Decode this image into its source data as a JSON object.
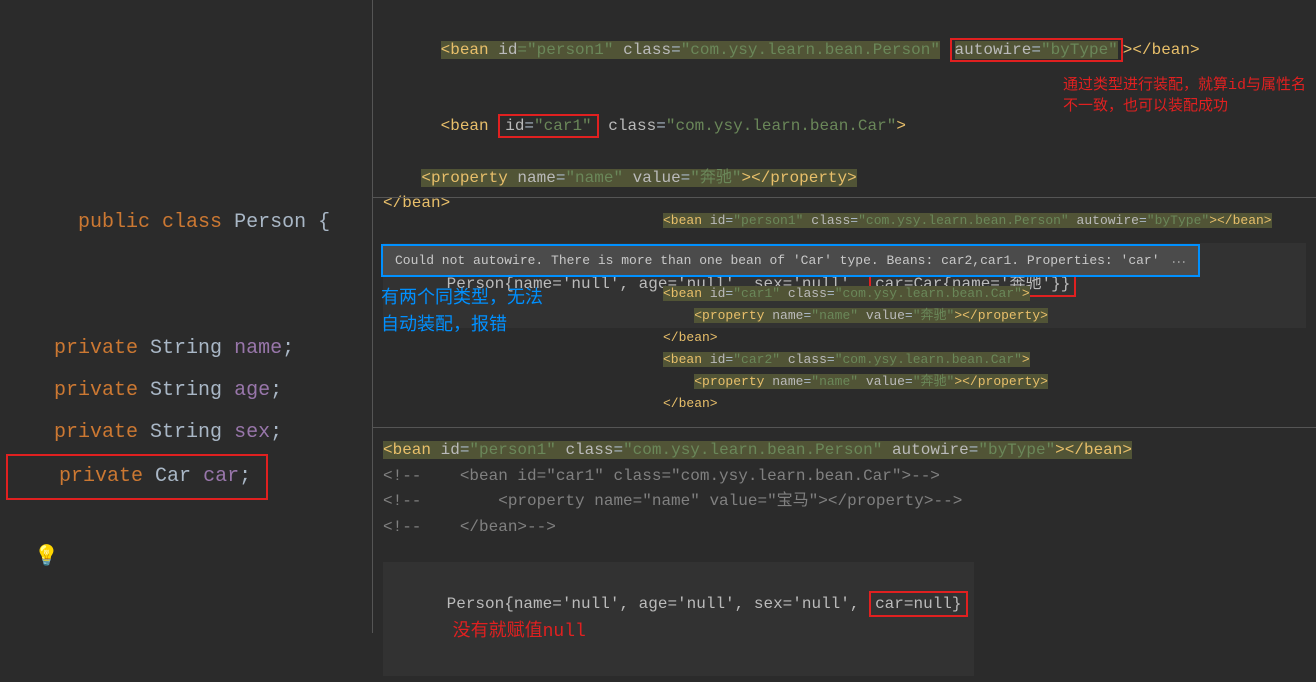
{
  "left": {
    "decl": {
      "kw1": "public",
      "kw2": "class",
      "name": "Person",
      "brace": "{"
    },
    "f1": {
      "kw": "private",
      "type": "String",
      "name": "name",
      "semi": ";"
    },
    "f2": {
      "kw": "private",
      "type": "String",
      "name": "age",
      "semi": ";"
    },
    "f3": {
      "kw": "private",
      "type": "String",
      "name": "sex",
      "semi": ";"
    },
    "f4": {
      "kw": "private",
      "type": "Car",
      "name": "car",
      "semi": ";"
    }
  },
  "sec1": {
    "line1": {
      "open": "<bean ",
      "a1n": "id",
      "eq": "=",
      "a1v": "\"person1\"",
      "a2n": "class",
      "a2v": "\"com.ysy.learn.bean.Person\"",
      "a3n": "autowire",
      "a3v": "\"byType\"",
      "close": "></bean>"
    },
    "line2": {
      "open": "<bean ",
      "a1n": "id",
      "a1v": "\"car1\"",
      "a2n": "class",
      "a2v": "\"com.ysy.learn.bean.Car\"",
      "close": ">"
    },
    "line3": {
      "indent": "    ",
      "open": "<property ",
      "a1n": "name",
      "a1v": "\"name\"",
      "a2n": "value",
      "a2v": "\"奔驰\"",
      "close": "></property>"
    },
    "line4": "</bean>",
    "ann1": "通过类型进行装配，就算id与属性名",
    "ann2": "不一致，也可以装配成功",
    "out_prefix": "Person{name='null', age='null', sex='null', ",
    "out_box": "car=Car{name='奔驰'}}"
  },
  "sec2": {
    "top": {
      "open": "<bean ",
      "a1n": "id",
      "a1v": "\"person1\"",
      "a2n": "class",
      "a2v": "\"com.ysy.learn.bean.Person\"",
      "a3n": "autowire",
      "a3v": "\"byType\"",
      "close": "></bean>"
    },
    "tooltip": "Could not autowire. There is more than one bean of 'Car' type. Beans: car2,car1. Properties: 'car'",
    "ann1": "有两个同类型，无法",
    "ann2": "自动装配，报错",
    "car1": {
      "open": "<bean ",
      "a1n": "id",
      "a1v": "\"car1\"",
      "a2n": "class",
      "a2v": "\"com.ysy.learn.bean.Car\"",
      "close": ">"
    },
    "prop": {
      "indent": "    ",
      "open": "<property ",
      "a1n": "name",
      "a1v": "\"name\"",
      "a2n": "value",
      "a2v": "\"奔驰\"",
      "close": "></property>"
    },
    "end": "</bean>",
    "car2": {
      "open": "<bean ",
      "a1n": "id",
      "a1v": "\"car2\"",
      "a2n": "class",
      "a2v": "\"com.ysy.learn.bean.Car\"",
      "close": ">"
    }
  },
  "sec3": {
    "line1": {
      "open": "<bean ",
      "a1n": "id",
      "a1v": "\"person1\"",
      "a2n": "class",
      "a2v": "\"com.ysy.learn.bean.Person\"",
      "a3n": "autowire",
      "a3v": "\"byType\"",
      "close": "></bean>"
    },
    "c1": "<!--    <bean id=\"car1\" class=\"com.ysy.learn.bean.Car\">-->",
    "c2": "<!--        <property name=\"name\" value=\"宝马\"></property>-->",
    "c3": "<!--    </bean>-->",
    "out_prefix": "Person{name='null', age='null', sex='null', ",
    "out_box": "car=null}",
    "ann": "没有就赋值null"
  }
}
